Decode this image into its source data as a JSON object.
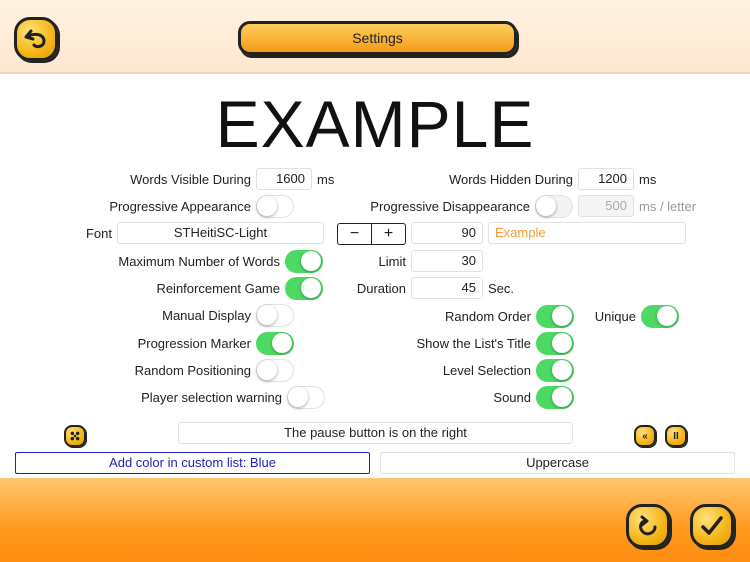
{
  "header": {
    "title": "Settings"
  },
  "preview": {
    "text": "EXAMPLE",
    "sample": "Example"
  },
  "left": {
    "words_visible": {
      "label": "Words Visible During",
      "value": "1600",
      "unit": "ms"
    },
    "progressive_appearance": {
      "label": "Progressive Appearance",
      "on": false
    },
    "font": {
      "label": "Font",
      "value": "STHeitiSC-Light"
    },
    "max_words": {
      "label": "Maximum Number of Words",
      "on": true
    },
    "reinforcement": {
      "label": "Reinforcement Game",
      "on": true
    },
    "manual_display": {
      "label": "Manual Display",
      "on": false
    },
    "progression_marker": {
      "label": "Progression Marker",
      "on": true
    },
    "random_positioning": {
      "label": "Random Positioning",
      "on": false
    },
    "player_warning": {
      "label": "Player selection warning",
      "on": false
    }
  },
  "right": {
    "words_hidden": {
      "label": "Words Hidden During",
      "value": "1200",
      "unit": "ms"
    },
    "progressive_disappearance": {
      "label": "Progressive Disappearance",
      "on": false,
      "value": "500",
      "unit": "ms / letter"
    },
    "font_size": {
      "value": "90",
      "minus": "−",
      "plus": "+"
    },
    "limit": {
      "label": "Limit",
      "value": "30"
    },
    "duration": {
      "label": "Duration",
      "value": "45",
      "unit": "Sec."
    },
    "random_order": {
      "label": "Random Order",
      "on": true
    },
    "unique": {
      "label": "Unique",
      "on": true
    },
    "show_title": {
      "label": "Show the List's Title",
      "on": true
    },
    "level_selection": {
      "label": "Level Selection",
      "on": true
    },
    "sound": {
      "label": "Sound",
      "on": true
    }
  },
  "pause": {
    "text": "The pause button is on the right",
    "rewind": "«",
    "pause": "II"
  },
  "actions": {
    "add_color": "Add color in custom list: Blue",
    "case": "Uppercase"
  },
  "colors": {
    "accent": "#ff9a1e",
    "switch_on": "#4cd964",
    "link": "#2020c0",
    "sample": "#f39a34"
  }
}
